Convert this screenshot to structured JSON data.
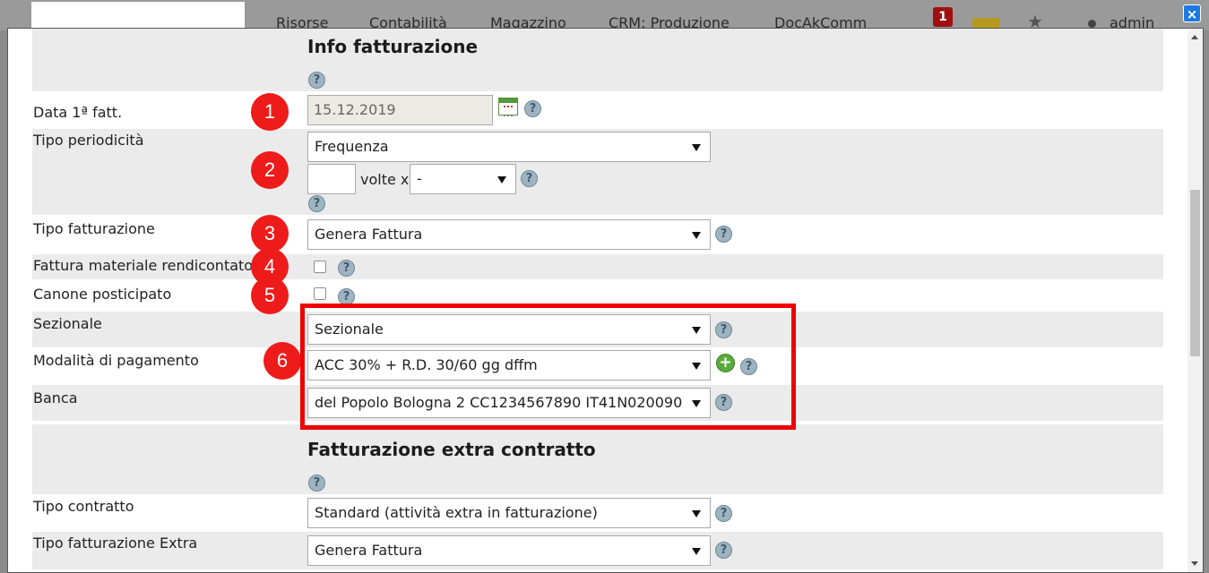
{
  "topnav": {
    "items": [
      "Risorse",
      "Contabilità",
      "Magazzino",
      "CRM: Produzione",
      "DocAkComm"
    ],
    "notification_count": "1",
    "user": "admin"
  },
  "modal": {
    "close_label": "×",
    "section_info": {
      "title": "Info fatturazione",
      "help": "?"
    },
    "data_prima_fatt": {
      "label": "Data 1ª fatt.",
      "value": "15.12.2019",
      "marker": "1"
    },
    "tipo_periodicita": {
      "label": "Tipo periodicità",
      "selected": "Frequenza",
      "times_value": "",
      "times_label": "volte x",
      "unit_selected": "-",
      "marker": "2"
    },
    "tipo_fatturazione": {
      "label": "Tipo fatturazione",
      "selected": "Genera Fattura",
      "marker": "3"
    },
    "fattura_materiale": {
      "label": "Fattura materiale rendicontato",
      "checked": false,
      "marker": "4"
    },
    "canone_posticipato": {
      "label": "Canone posticipato",
      "checked": false,
      "marker": "5"
    },
    "sezionale": {
      "label": "Sezionale",
      "selected": "Sezionale"
    },
    "modalita_pagamento": {
      "label": "Modalità di pagamento",
      "selected": "ACC 30% + R.D. 30/60 gg dffm",
      "marker": "6"
    },
    "banca": {
      "label": "Banca",
      "selected": "del Popolo Bologna 2 CC1234567890 IT41N020090"
    },
    "section_extra": {
      "title": "Fatturazione extra contratto",
      "help": "?"
    },
    "tipo_contratto": {
      "label": "Tipo contratto",
      "selected": "Standard (attività extra in fatturazione)"
    },
    "tipo_fatturazione_extra": {
      "label": "Tipo fatturazione Extra",
      "selected": "Genera Fattura"
    },
    "colors": {
      "marker": "#ee1b1b",
      "highlight": "#ee0000",
      "row_shade": "#ebebeb"
    }
  }
}
